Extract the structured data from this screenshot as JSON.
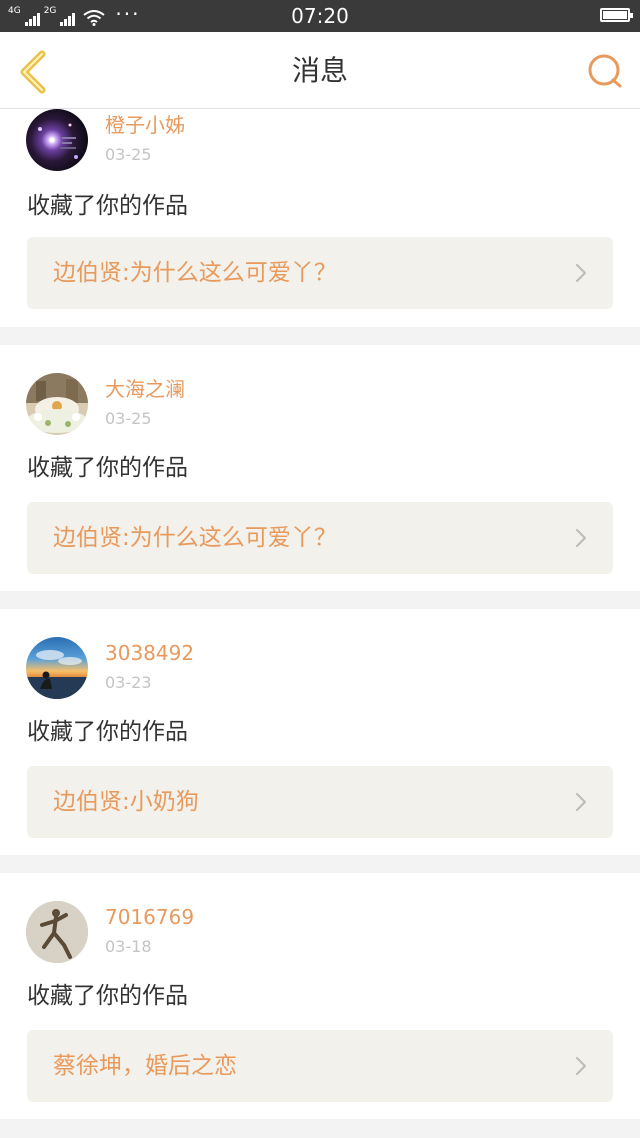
{
  "status_bar": {
    "network_1": "4G",
    "network_2": "2G",
    "more": "···",
    "time": "07:20"
  },
  "header": {
    "title": "消息",
    "back_icon": "chevron-left-icon",
    "search_icon": "search-icon"
  },
  "colors": {
    "accent": "#e89a5d",
    "back_icon": "#e9c34a",
    "card_inner": "#f3f1ec",
    "page_bg": "#f3f3f3"
  },
  "messages": [
    {
      "user": "橙子小姊",
      "date": "03-25",
      "action": "收藏了你的作品",
      "work": "边伯贤:为什么这么可爱丫？"
    },
    {
      "user": "大海之澜",
      "date": "03-25",
      "action": "收藏了你的作品",
      "work": "边伯贤:为什么这么可爱丫？"
    },
    {
      "user": "3038492",
      "date": "03-23",
      "action": "收藏了你的作品",
      "work": "边伯贤:小奶狗"
    },
    {
      "user": "7016769",
      "date": "03-18",
      "action": "收藏了你的作品",
      "work": "蔡徐坤，婚后之恋"
    }
  ]
}
